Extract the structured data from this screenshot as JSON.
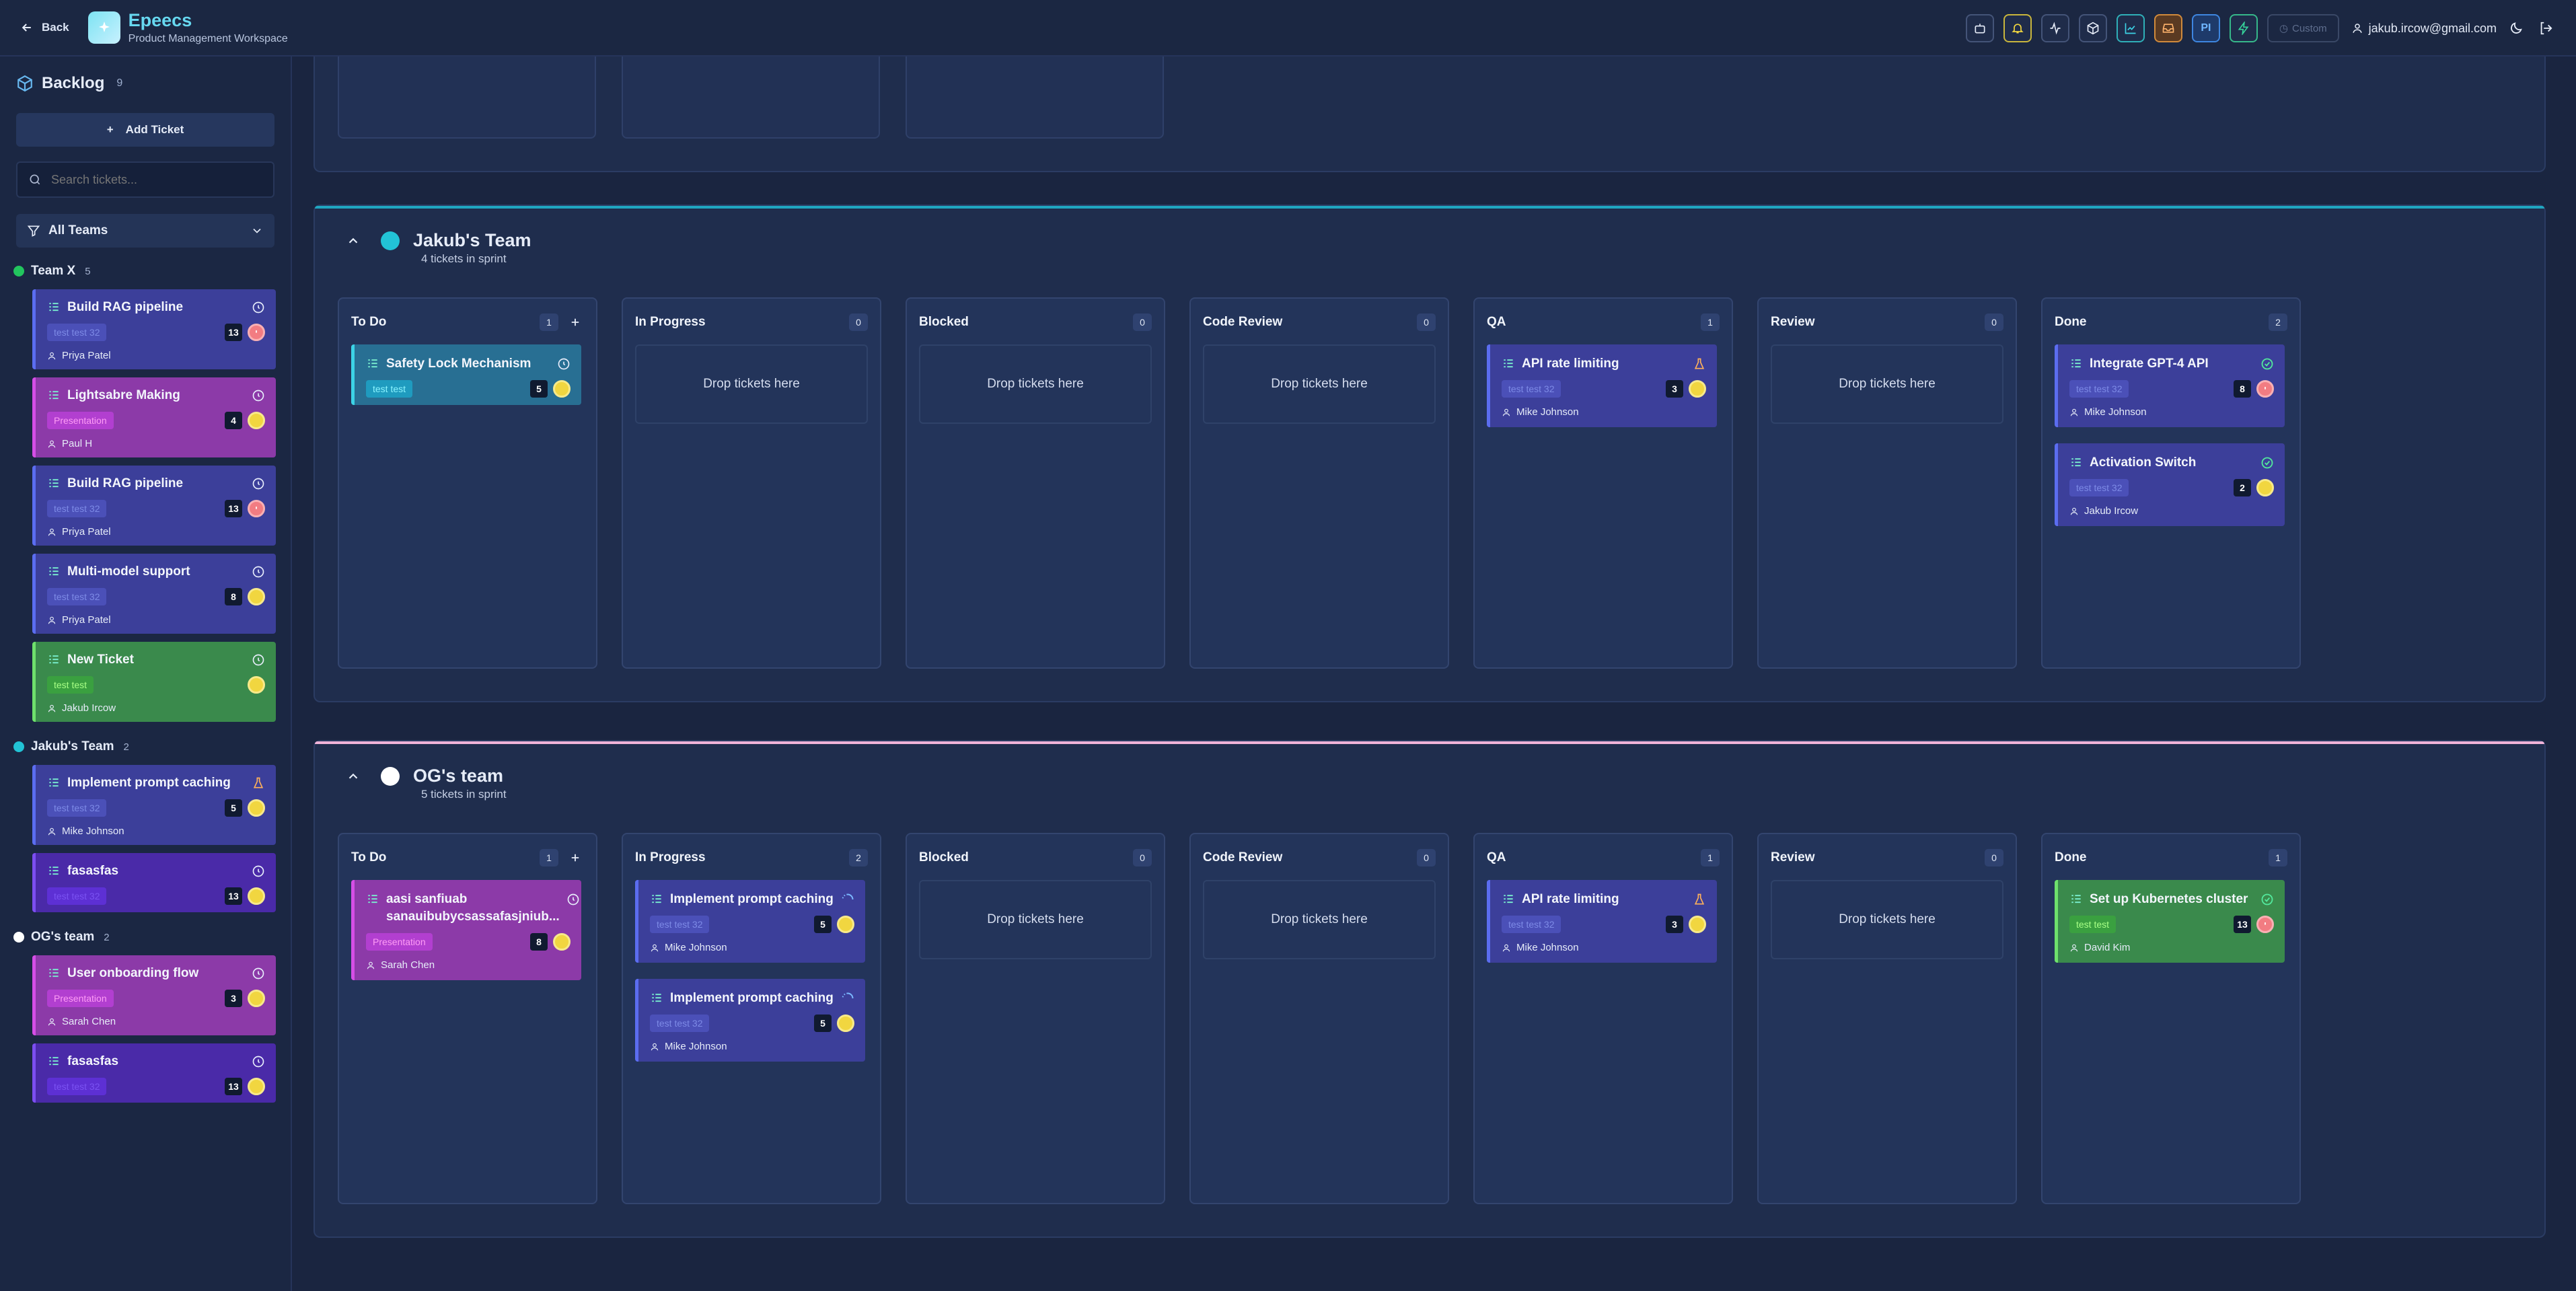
{
  "header": {
    "back_label": "Back",
    "brand_title": "Epeecs",
    "brand_subtitle": "Product Management Workspace",
    "pi_label": "PI",
    "custom_label": "Custom",
    "user_email": "jakub.ircow@gmail.com"
  },
  "sidebar": {
    "title": "Backlog",
    "count": "9",
    "add_ticket_label": "Add Ticket",
    "search_placeholder": "Search tickets...",
    "filter_label": "All Teams",
    "teams": [
      {
        "name": "Team X",
        "count": "5",
        "color": "#22c55e",
        "cards": [
          {
            "title": "Build RAG pipeline",
            "tag": "test test 32",
            "points": "13",
            "assignee": "Priya Patel"
          },
          {
            "title": "Lightsabre Making",
            "tag": "Presentation",
            "points": "4",
            "assignee": "Paul H"
          },
          {
            "title": "Build RAG pipeline",
            "tag": "test test 32",
            "points": "13",
            "assignee": "Priya Patel"
          },
          {
            "title": "Multi-model support",
            "tag": "test test 32",
            "points": "8",
            "assignee": "Priya Patel"
          },
          {
            "title": "New Ticket",
            "tag": "test test",
            "points": "",
            "assignee": "Jakub Ircow"
          }
        ]
      },
      {
        "name": "Jakub's Team",
        "count": "2",
        "color": "#22c3d6",
        "cards": [
          {
            "title": "Implement prompt caching",
            "tag": "test test 32",
            "points": "5",
            "assignee": "Mike Johnson"
          },
          {
            "title": "fasasfas",
            "tag": "test test 32",
            "points": "13",
            "assignee": ""
          }
        ]
      },
      {
        "name": "OG's team",
        "count": "2",
        "color": "#ffffff",
        "cards": [
          {
            "title": "User onboarding flow",
            "tag": "Presentation",
            "points": "3",
            "assignee": "Sarah Chen"
          },
          {
            "title": "fasasfas",
            "tag": "test test 32",
            "points": "13",
            "assignee": ""
          }
        ]
      }
    ]
  },
  "board": {
    "drop_label": "Drop tickets here",
    "sections": [
      {
        "name": "Jakub's Team",
        "subtitle": "4 tickets in sprint",
        "color": "#22c3d6",
        "columns": [
          {
            "name": "To Do",
            "count": "1",
            "cards": [
              {
                "title": "Safety Lock Mechanism",
                "tag": "test test",
                "points": "5",
                "assignee": ""
              }
            ]
          },
          {
            "name": "In Progress",
            "count": "0"
          },
          {
            "name": "Blocked",
            "count": "0"
          },
          {
            "name": "Code Review",
            "count": "0"
          },
          {
            "name": "QA",
            "count": "1",
            "cards": [
              {
                "title": "API rate limiting",
                "tag": "test test 32",
                "points": "3",
                "assignee": "Mike Johnson"
              }
            ]
          },
          {
            "name": "Review",
            "count": "0"
          },
          {
            "name": "Done",
            "count": "2",
            "cards": [
              {
                "title": "Integrate GPT-4 API",
                "tag": "test test 32",
                "points": "8",
                "assignee": "Mike Johnson"
              },
              {
                "title": "Activation Switch",
                "tag": "test test 32",
                "points": "2",
                "assignee": "Jakub Ircow"
              }
            ]
          }
        ]
      },
      {
        "name": "OG's team",
        "subtitle": "5 tickets in sprint",
        "color": "#ffffff",
        "columns": [
          {
            "name": "To Do",
            "count": "1",
            "cards": [
              {
                "title": "aasi sanfiuab sanauibubycsassafasjniub...",
                "tag": "Presentation",
                "points": "8",
                "assignee": "Sarah Chen"
              }
            ]
          },
          {
            "name": "In Progress",
            "count": "2",
            "cards": [
              {
                "title": "Implement prompt caching",
                "tag": "test test 32",
                "points": "5",
                "assignee": "Mike Johnson"
              },
              {
                "title": "Implement prompt caching",
                "tag": "test test 32",
                "points": "5",
                "assignee": "Mike Johnson"
              }
            ]
          },
          {
            "name": "Blocked",
            "count": "0"
          },
          {
            "name": "Code Review",
            "count": "0"
          },
          {
            "name": "QA",
            "count": "1",
            "cards": [
              {
                "title": "API rate limiting",
                "tag": "test test 32",
                "points": "3",
                "assignee": "Mike Johnson"
              }
            ]
          },
          {
            "name": "Review",
            "count": "0"
          },
          {
            "name": "Done",
            "count": "1",
            "cards": [
              {
                "title": "Set up Kubernetes cluster",
                "tag": "test test",
                "points": "13",
                "assignee": "David Kim"
              }
            ]
          }
        ]
      }
    ]
  }
}
